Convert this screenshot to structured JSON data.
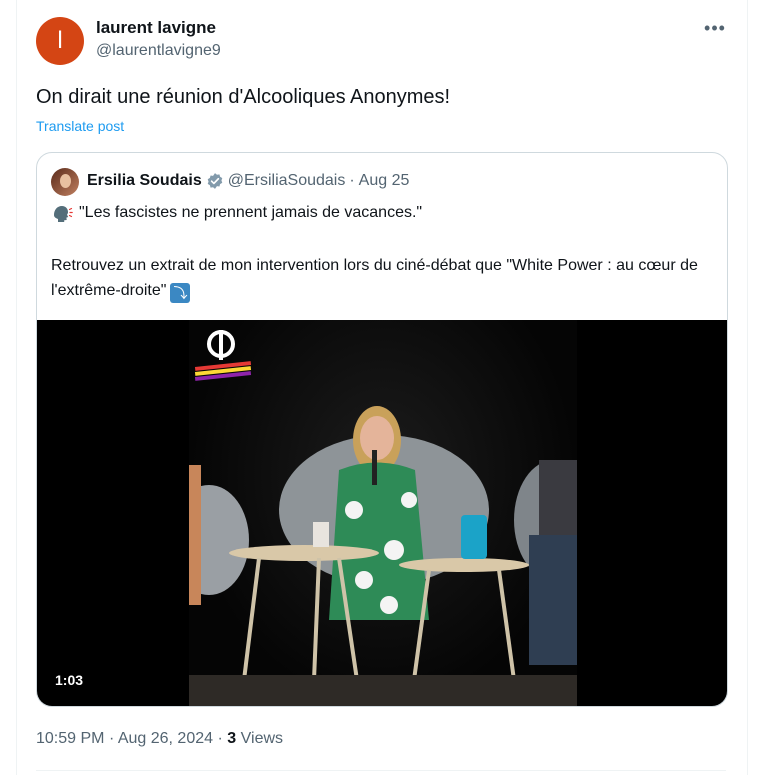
{
  "post": {
    "author": {
      "name": "laurent lavigne",
      "handle": "@laurentlavigne9",
      "avatar_letter": "l",
      "avatar_color": "#d44514"
    },
    "more_label": "•••",
    "text": "On dirait une réunion d'Alcooliques Anonymes!",
    "translate_label": "Translate post",
    "quote": {
      "name": "Ersilia Soudais",
      "verified": true,
      "handle": "@ErsiliaSoudais",
      "separator": "·",
      "date": "Aug 25",
      "icon_speaking": "speaking-head-icon",
      "line1": "\"Les fascistes ne prennent jamais de vacances.\"",
      "line2": "Retrouvez un extrait de mon intervention lors du ciné-débat que \"White Power : au cœur de l'extrême-droite\"",
      "icon_arrow": "arrow-down-icon",
      "video": {
        "duration": "1:03"
      }
    },
    "meta": {
      "time": "10:59 PM",
      "separator": "·",
      "date": "Aug 26, 2024",
      "views_count": "3",
      "views_label": "Views"
    }
  },
  "colors": {
    "accent": "#1d9bf0",
    "muted": "#536471",
    "verified": "#829aab"
  }
}
